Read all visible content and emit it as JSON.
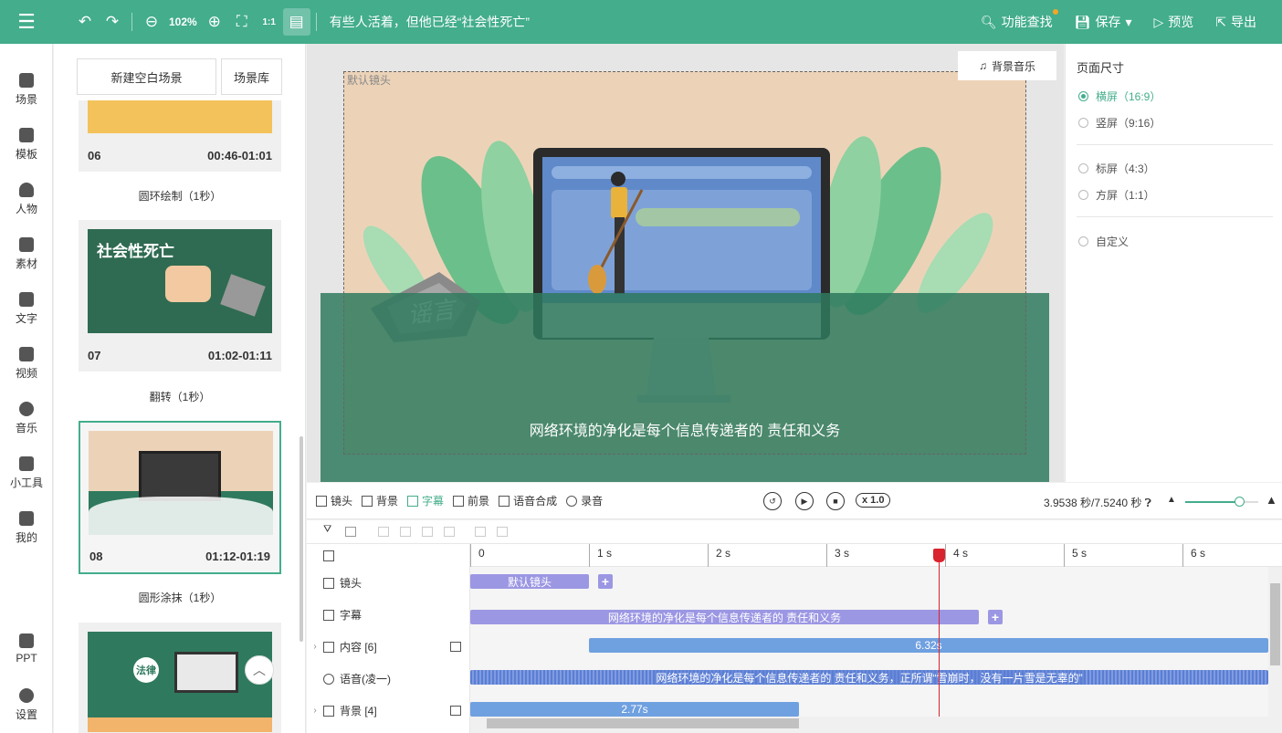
{
  "topbar": {
    "zoom": "102%",
    "ratio_icon_label": "1:1",
    "title": "有些人活着，但他已经“社会性死亡”",
    "feature_search": "功能查找",
    "save": "保存",
    "preview": "预览",
    "export": "导出"
  },
  "nav": [
    {
      "label": "场景",
      "icon": "scene-icon"
    },
    {
      "label": "模板",
      "icon": "template-icon"
    },
    {
      "label": "人物",
      "icon": "person-icon"
    },
    {
      "label": "素材",
      "icon": "material-icon"
    },
    {
      "label": "文字",
      "icon": "text-icon"
    },
    {
      "label": "视频",
      "icon": "video-icon"
    },
    {
      "label": "音乐",
      "icon": "music-icon"
    },
    {
      "label": "小工具",
      "icon": "toolbox-icon"
    },
    {
      "label": "我的",
      "icon": "upload-icon"
    },
    {
      "label": "PPT",
      "icon": "ppt-icon"
    },
    {
      "label": "设置",
      "icon": "gear-icon"
    }
  ],
  "scenes": {
    "new_blank": "新建空白场景",
    "library": "场景库",
    "cards": [
      {
        "no": "06",
        "time": "00:46-01:01",
        "transition": "圆环绘制（1秒）"
      },
      {
        "no": "07",
        "time": "01:02-01:11",
        "transition": "翻转（1秒）",
        "thumb_title": "社会性死亡"
      },
      {
        "no": "08",
        "time": "01:12-01:19",
        "transition": "圆形涂抹（1秒）"
      }
    ],
    "card09_badge": "法律"
  },
  "stage": {
    "label": "默认镜头",
    "bgm": "背景音乐",
    "rock_text": "谣言",
    "subtitle": "网络环境的净化是每个信息传递者的 责任和义务"
  },
  "page_size": {
    "title": "页面尺寸",
    "options": [
      {
        "label": "横屏（16:9）",
        "selected": true
      },
      {
        "label": "竖屏（9:16）",
        "selected": false
      },
      {
        "label": "标屏（4:3）",
        "selected": false
      },
      {
        "label": "方屏（1:1）",
        "selected": false
      },
      {
        "label": "自定义",
        "selected": false
      }
    ]
  },
  "timeline": {
    "tabs": [
      "镜头",
      "背景",
      "字幕",
      "前景",
      "语音合成",
      "录音"
    ],
    "active_tab": "字幕",
    "speed": "x 1.0",
    "time_readout": "3.9538 秒/7.5240 秒",
    "zoom_level": 0.75,
    "ruler": [
      "0",
      "1 s",
      "2 s",
      "3 s",
      "4 s",
      "5 s",
      "6 s"
    ],
    "tracks": [
      {
        "label": "镜头",
        "expandable": false
      },
      {
        "label": "字幕",
        "expandable": false
      },
      {
        "label": "内容 [6]",
        "expandable": true
      },
      {
        "label": "语音(凌一)",
        "expandable": false
      },
      {
        "label": "背景 [4]",
        "expandable": true
      }
    ],
    "segments": {
      "camera": "默认镜头",
      "subtitle": "网络环境的净化是每个信息传递者的 责任和义务",
      "content": "6.32s",
      "voice": "网络环境的净化是每个信息传递者的 责任和义务，正所谓“雪崩时，没有一片雪是无辜的”",
      "background": "2.77s"
    }
  },
  "colors": {
    "brand": "#43ad8c",
    "playhead": "#d9232e",
    "segment_purple": "#9c97e3",
    "segment_blue": "#6fa0e0"
  }
}
